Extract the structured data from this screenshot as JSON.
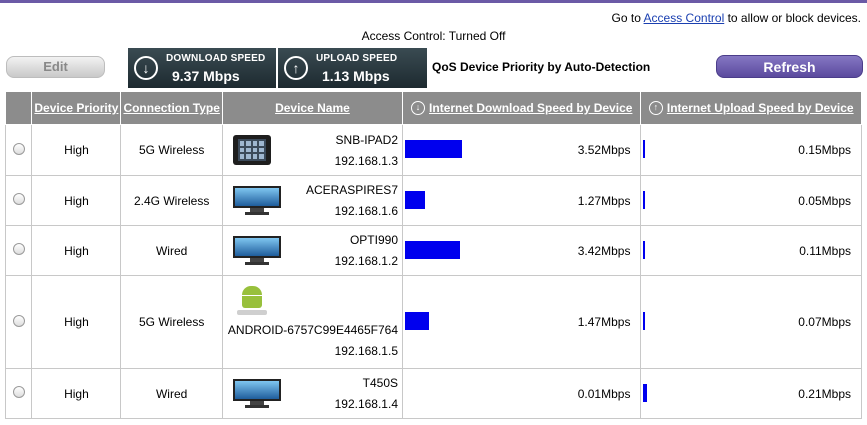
{
  "header": {
    "goto_prefix": "Go to",
    "goto_link": "Access Control",
    "goto_suffix": "to allow or block devices.",
    "access_status": "Access Control: Turned Off",
    "edit_label": "Edit",
    "refresh_label": "Refresh",
    "qos_label": "QoS Device Priority by Auto-Detection"
  },
  "speeds": {
    "download_title": "DOWNLOAD SPEED",
    "download_value": "9.37 Mbps",
    "upload_title": "UPLOAD SPEED",
    "upload_value": "1.13 Mbps"
  },
  "table": {
    "columns": {
      "priority": "Device Priority",
      "connection": "Connection Type",
      "name": "Device Name",
      "download": "Internet Download Speed by Device",
      "upload": "Internet Upload Speed by Device"
    },
    "rows": [
      {
        "priority": "High",
        "connection": "5G Wireless",
        "name": "SNB-IPAD2",
        "ip": "192.168.1.3",
        "icon": "tablet-icon",
        "download": "3.52Mbps",
        "download_fraction": 0.0587,
        "upload": "0.15Mbps",
        "upload_fraction": 0.0025
      },
      {
        "priority": "High",
        "connection": "2.4G Wireless",
        "name": "ACERASPIRES7",
        "ip": "192.168.1.6",
        "icon": "monitor-icon",
        "download": "1.27Mbps",
        "download_fraction": 0.0212,
        "upload": "0.05Mbps",
        "upload_fraction": 0.0008
      },
      {
        "priority": "High",
        "connection": "Wired",
        "name": "OPTI990",
        "ip": "192.168.1.2",
        "icon": "monitor-icon",
        "download": "3.42Mbps",
        "download_fraction": 0.057,
        "upload": "0.11Mbps",
        "upload_fraction": 0.0018
      },
      {
        "priority": "High",
        "connection": "5G Wireless",
        "name": "ANDROID-6757C99E4465F764",
        "ip": "192.168.1.5",
        "icon": "android-icon",
        "download": "1.47Mbps",
        "download_fraction": 0.0245,
        "upload": "0.07Mbps",
        "upload_fraction": 0.0012
      },
      {
        "priority": "High",
        "connection": "Wired",
        "name": "T450S",
        "ip": "192.168.1.4",
        "icon": "monitor-icon",
        "download": "0.01Mbps",
        "download_fraction": 0.0002,
        "upload": "0.21Mbps",
        "upload_fraction": 0.0035
      }
    ]
  },
  "colors": {
    "accent": "#6b5aa6",
    "bar": "#0000ee",
    "header_bg": "#8c8c8c"
  }
}
